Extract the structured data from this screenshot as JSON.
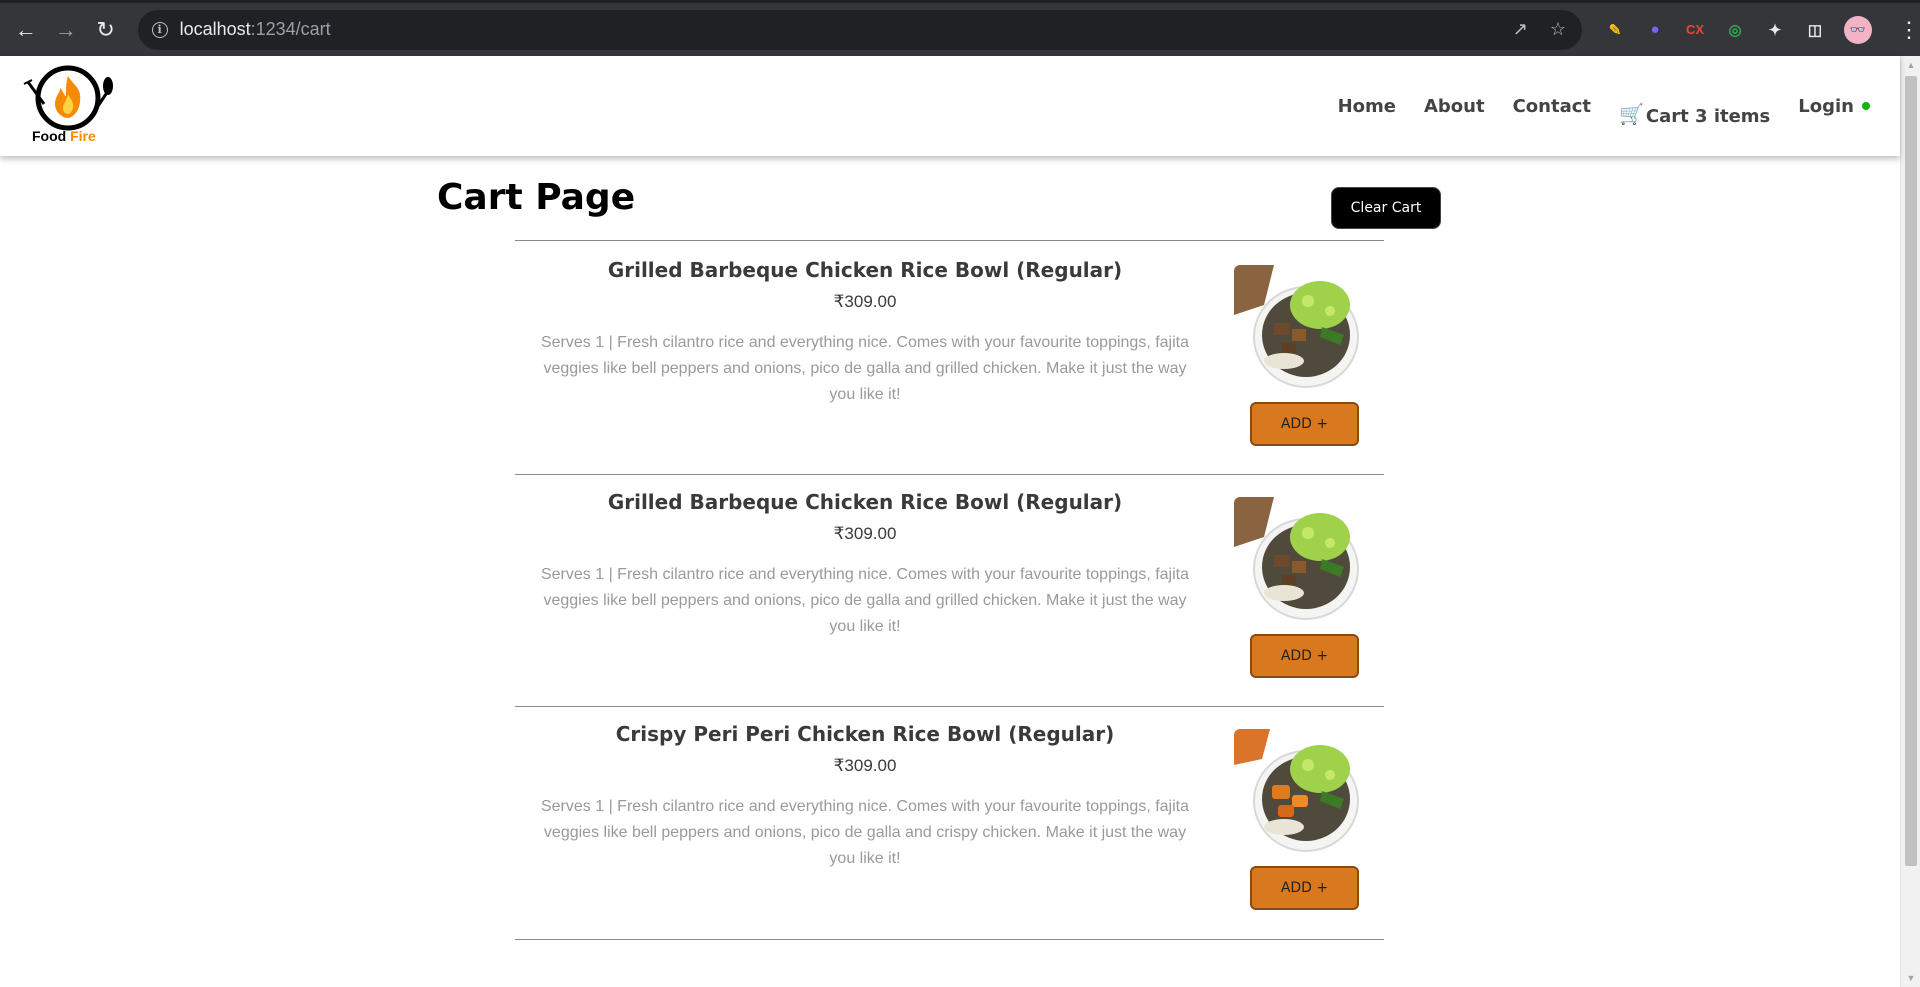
{
  "browser": {
    "url_host": "localhost",
    "url_path": ":1234/cart",
    "info_icon": "info-icon",
    "extensions": [
      "broom-extension",
      "drop-extension",
      "cx-extension",
      "target-extension",
      "puzzle-extension",
      "sidepanel-icon"
    ],
    "avatar_glyph": "👓"
  },
  "header": {
    "logo_text_food": "Food",
    "logo_text_fire": " Fire",
    "nav": {
      "home": "Home",
      "about": "About",
      "contact": "Contact",
      "cart": "Cart 3 items",
      "login": "Login"
    },
    "login_status_color": "#12b312"
  },
  "cart": {
    "title": "Cart Page",
    "clear_label": "Clear Cart",
    "items": [
      {
        "name": "Grilled Barbeque Chicken Rice Bowl (Regular)",
        "price": "₹309.00",
        "description": "Serves 1 | Fresh cilantro rice and everything nice. Comes with your favourite toppings, fajita veggies like bell peppers and onions, pico de galla and grilled chicken. Make it just the way you like it!",
        "add_label": "ADD +"
      },
      {
        "name": "Grilled Barbeque Chicken Rice Bowl (Regular)",
        "price": "₹309.00",
        "description": "Serves 1 | Fresh cilantro rice and everything nice. Comes with your favourite toppings, fajita veggies like bell peppers and onions, pico de galla and grilled chicken. Make it just the way you like it!",
        "add_label": "ADD +"
      },
      {
        "name": "Crispy Peri Peri Chicken Rice Bowl (Regular)",
        "price": "₹309.00",
        "description": "Serves 1 | Fresh cilantro rice and everything nice. Comes with your favourite toppings, fajita veggies like bell peppers and onions, pico de galla and crispy chicken. Make it just the way you like it!",
        "add_label": "ADD +"
      }
    ]
  },
  "colors": {
    "accent_button": "#d9791f",
    "brand_orange": "#f58a07"
  }
}
